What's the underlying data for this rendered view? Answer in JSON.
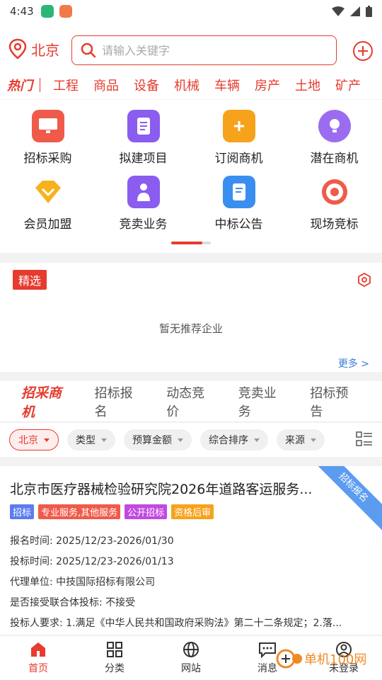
{
  "status": {
    "time": "4:43"
  },
  "header": {
    "city": "北京",
    "search_placeholder": "请输入关键字",
    "hot_label": "热门",
    "hot_keywords": [
      "工程",
      "商品",
      "设备",
      "机械",
      "车辆",
      "房产",
      "土地",
      "矿产"
    ]
  },
  "grid": [
    {
      "label": "招标采购",
      "icon": "monitor-icon",
      "color": "#f05a4a"
    },
    {
      "label": "拟建项目",
      "icon": "document-icon",
      "color": "#8a5cf0"
    },
    {
      "label": "订阅商机",
      "icon": "subscribe-icon",
      "color": "#f7a21b"
    },
    {
      "label": "潜在商机",
      "icon": "bulb-icon",
      "color": "#9b6cf0"
    },
    {
      "label": "会员加盟",
      "icon": "diamond-icon",
      "color": "#f7b21b"
    },
    {
      "label": "竞卖业务",
      "icon": "auction-icon",
      "color": "#8a5cf0"
    },
    {
      "label": "中标公告",
      "icon": "announcement-icon",
      "color": "#3a8ef0"
    },
    {
      "label": "现场竞标",
      "icon": "target-icon",
      "color": "#f05a4a"
    }
  ],
  "featured": {
    "tag": "精选",
    "empty_text": "暂无推荐企业",
    "more": "更多 >"
  },
  "tabs": {
    "brand": "招采商机",
    "items": [
      "招标报名",
      "动态竞价",
      "竞卖业务",
      "招标预告"
    ]
  },
  "filters": [
    "北京",
    "类型",
    "预算金额",
    "综合排序",
    "来源"
  ],
  "card": {
    "ribbon": "招标报名",
    "title": "北京市医疗器械检验研究院2026年道路客运服务...",
    "tags": [
      {
        "text": "招标",
        "color": "#5b7cf0"
      },
      {
        "text": "专业服务,其他服务",
        "color": "#f05a4a"
      },
      {
        "text": "公开招标",
        "color": "#c24ae0"
      },
      {
        "text": "资格后审",
        "color": "#f7a21b"
      }
    ],
    "fields": [
      "报名时间: 2025/12/23-2026/01/30",
      "投标时间: 2025/12/23-2026/01/13",
      "代理单位: 中技国际招标有限公司",
      "是否接受联合体投标: 不接受",
      "投标人要求: 1.满足《中华人民共和国政府采购法》第二十二条规定；2.落..."
    ]
  },
  "bottom_nav": [
    "首页",
    "分类",
    "网站",
    "消息",
    "未登录"
  ],
  "watermark": "单机100网"
}
